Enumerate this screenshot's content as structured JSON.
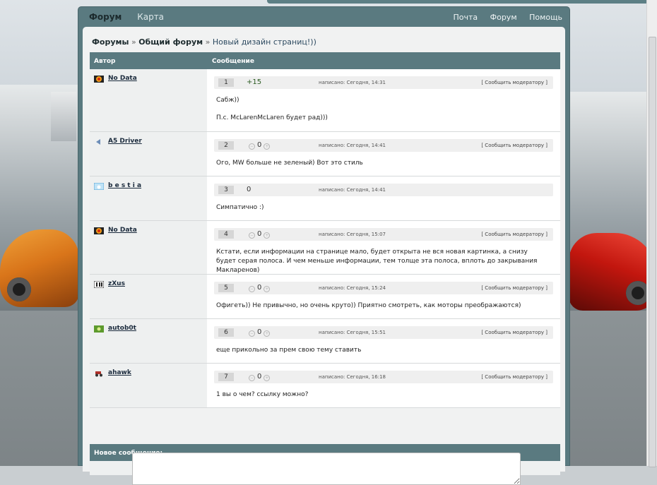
{
  "topnav": {
    "left": [
      {
        "label": "Форум",
        "active": true
      },
      {
        "label": "Карта",
        "active": false
      }
    ],
    "right": [
      {
        "label": "Почта"
      },
      {
        "label": "Форум"
      },
      {
        "label": "Помощь"
      }
    ]
  },
  "breadcrumb": {
    "forums": "Форумы",
    "sep1": "»",
    "general": "Общий форум",
    "sep2": "»",
    "topic": "Новый дизайн страниц!))"
  },
  "table_header": {
    "author": "Автор",
    "message": "Сообщение"
  },
  "posts": [
    {
      "author": "No Data",
      "avatar_icon": "flame-avatar-icon",
      "number": "1",
      "rating": "+15",
      "rating_type": "plain",
      "posted": "написано: Сегодня, 14:31",
      "report": "[ Сообщить модератору ]",
      "lines": [
        "Сабж))",
        "П.с. McLarenMcLaren будет рад)))"
      ]
    },
    {
      "author": "A5 Driver",
      "avatar_icon": "arrow-avatar-icon",
      "number": "2",
      "rating": "0",
      "rating_type": "dots",
      "posted": "написано: Сегодня, 14:41",
      "report": "[ Сообщить модератору ]",
      "lines": [
        "Ого, MW больше не зеленый) Вот это стиль"
      ]
    },
    {
      "author": "b e s t i a",
      "avatar_icon": "cloud-avatar-icon",
      "number": "3",
      "rating": "0",
      "rating_type": "plain",
      "posted": "написано: Сегодня, 14:41",
      "report": "",
      "lines": [
        "Симпатично :)"
      ]
    },
    {
      "author": "No Data",
      "avatar_icon": "flame-avatar-icon",
      "number": "4",
      "rating": "0",
      "rating_type": "dots",
      "posted": "написано: Сегодня, 15:07",
      "report": "[ Сообщить модератору ]",
      "lines": [
        "Кстати, если информации на странице мало, будет открыта не вся новая картинка, а снизу будет серая полоса. И чем меньше информации, тем толще эта полоса, вплоть до закрывания Макларенов)"
      ]
    },
    {
      "author": "zXus",
      "avatar_icon": "bars-avatar-icon",
      "number": "5",
      "rating": "0",
      "rating_type": "dots",
      "posted": "написано: Сегодня, 15:24",
      "report": "[ Сообщить модератору ]",
      "lines": [
        "Офигеть)) Не привычно, но очень круто)) Приятно смотреть, как моторы преображаются)"
      ]
    },
    {
      "author": "autob0t",
      "avatar_icon": "green-avatar-icon",
      "number": "6",
      "rating": "0",
      "rating_type": "dots",
      "posted": "написано: Сегодня, 15:51",
      "report": "[ Сообщить модератору ]",
      "lines": [
        "еще прикольно за прем свою тему ставить"
      ]
    },
    {
      "author": "ahawk",
      "avatar_icon": "tractor-avatar-icon",
      "number": "7",
      "rating": "0",
      "rating_type": "dots",
      "posted": "написано: Сегодня, 16:18",
      "report": "[ Сообщить модератору ]",
      "lines": [
        "1 вы о чем? ссылку можно?"
      ]
    }
  ],
  "new_message": {
    "title": "Новое сообщение:"
  }
}
